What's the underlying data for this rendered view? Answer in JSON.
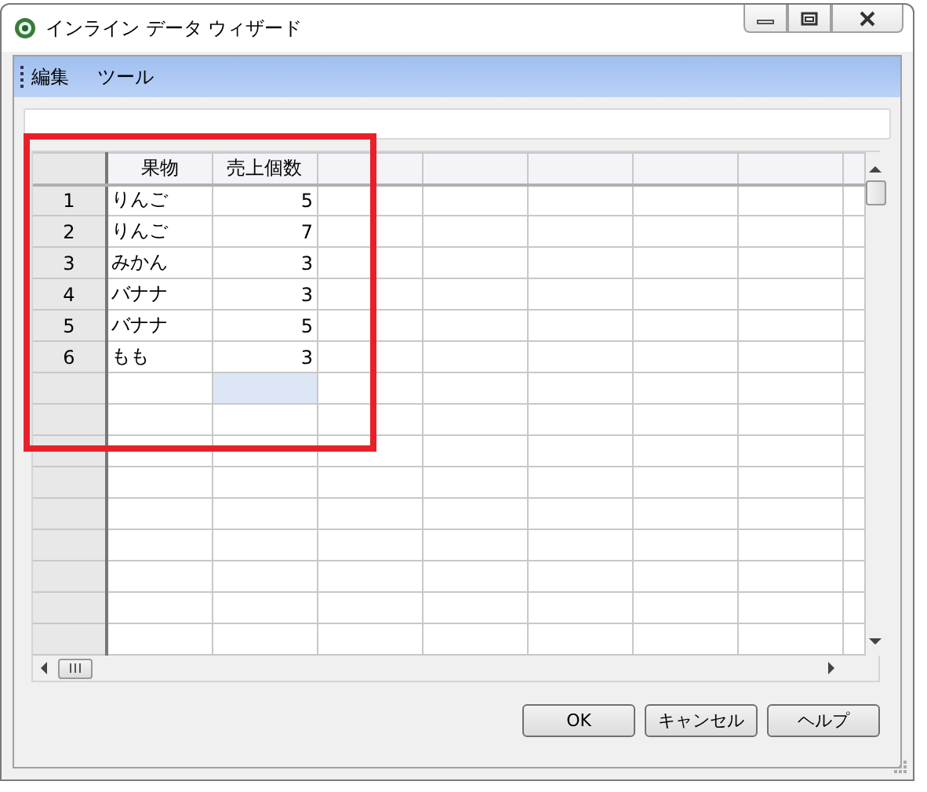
{
  "window": {
    "title": "インライン データ ウィザード"
  },
  "menu": [
    {
      "label": "編集"
    },
    {
      "label": "ツール"
    }
  ],
  "table": {
    "columns": [
      {
        "label": "果物",
        "kind": "text",
        "selected": false
      },
      {
        "label": "売上個数",
        "kind": "number",
        "selected": true
      }
    ],
    "rows": [
      {
        "number": "1",
        "cells": [
          "りんご",
          "5"
        ]
      },
      {
        "number": "2",
        "cells": [
          "りんご",
          "7"
        ]
      },
      {
        "number": "3",
        "cells": [
          "みかん",
          "3"
        ]
      },
      {
        "number": "4",
        "cells": [
          "バナナ",
          "3"
        ]
      },
      {
        "number": "5",
        "cells": [
          "バナナ",
          "5"
        ]
      },
      {
        "number": "6",
        "cells": [
          "もも",
          "3"
        ]
      }
    ]
  },
  "buttons": [
    {
      "label": "OK"
    },
    {
      "label": "キャンセル"
    },
    {
      "label": "ヘルプ"
    }
  ]
}
